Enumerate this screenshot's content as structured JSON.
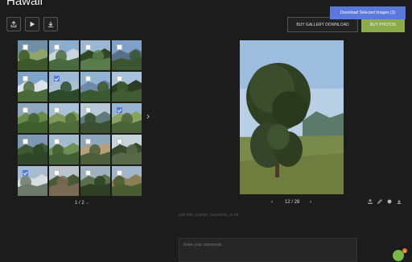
{
  "gallery": {
    "title": "Hawaii"
  },
  "toolbar": {
    "share": "share-icon",
    "play": "play-icon",
    "download": "download-icon"
  },
  "actions": {
    "download_selected": "Download Selected Images (3)",
    "buy_gallery_download": "BUY GALLERY DOWNLOAD",
    "buy_photos": "BUY PHOTOS"
  },
  "thumbs": [
    {
      "checked": false
    },
    {
      "checked": false
    },
    {
      "checked": false
    },
    {
      "checked": false
    },
    {
      "checked": false
    },
    {
      "checked": true
    },
    {
      "checked": false
    },
    {
      "checked": false
    },
    {
      "checked": false
    },
    {
      "checked": false
    },
    {
      "checked": false
    },
    {
      "checked": true
    },
    {
      "checked": false
    },
    {
      "checked": false
    },
    {
      "checked": false
    },
    {
      "checked": false
    },
    {
      "checked": true
    },
    {
      "checked": false
    },
    {
      "checked": false
    },
    {
      "checked": false
    }
  ],
  "grid_pager": {
    "label": "1 / 2"
  },
  "preview": {
    "counter": "12 / 28"
  },
  "caption": {
    "placeholder": "add title, caption, keywords, or alt"
  },
  "comment": {
    "placeholder": "Enter your comments"
  },
  "chat": {
    "badge": "1"
  }
}
